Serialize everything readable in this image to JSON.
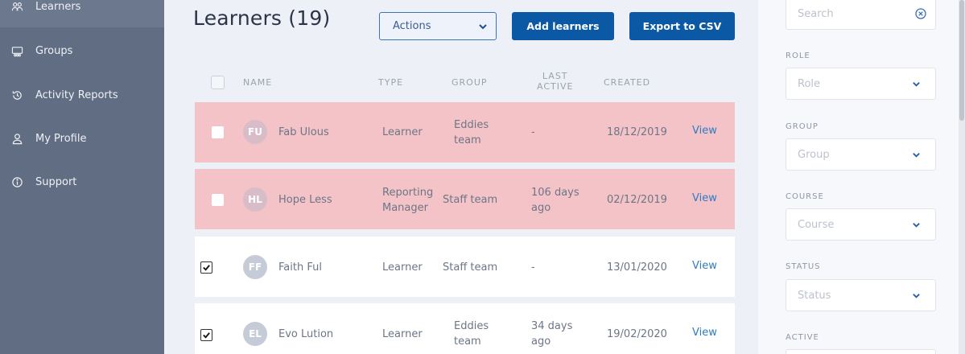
{
  "sidebar": {
    "items": [
      {
        "label": "Learners",
        "icon": "learners-icon"
      },
      {
        "label": "Groups",
        "icon": "groups-icon"
      },
      {
        "label": "Activity Reports",
        "icon": "history-icon"
      },
      {
        "label": "My Profile",
        "icon": "profile-icon"
      },
      {
        "label": "Support",
        "icon": "info-icon"
      }
    ]
  },
  "main": {
    "title": "Learners (19)",
    "actions_label": "Actions",
    "add_learners_label": "Add learners",
    "export_label": "Export to CSV",
    "columns": {
      "name": "NAME",
      "type": "TYPE",
      "group": "GROUP",
      "last_active_1": "LAST",
      "last_active_2": "ACTIVE",
      "created": "CREATED"
    },
    "rows": [
      {
        "initials": "FU",
        "name": "Fab Ulous",
        "type_1": "Learner",
        "type_2": "",
        "group_1": "Eddies",
        "group_2": "team",
        "last_1": "-",
        "last_2": "",
        "created": "18/12/2019",
        "view": "View",
        "checked": false
      },
      {
        "initials": "HL",
        "name": "Hope Less",
        "type_1": "Reporting",
        "type_2": "Manager",
        "group_1": "Staff team",
        "group_2": "",
        "last_1": "106 days",
        "last_2": "ago",
        "created": "02/12/2019",
        "view": "View",
        "checked": false
      },
      {
        "initials": "FF",
        "name": "Faith Ful",
        "type_1": "Learner",
        "type_2": "",
        "group_1": "Staff team",
        "group_2": "",
        "last_1": "-",
        "last_2": "",
        "created": "13/01/2020",
        "view": "View",
        "checked": true
      },
      {
        "initials": "EL",
        "name": "Evo Lution",
        "type_1": "Learner",
        "type_2": "",
        "group_1": "Eddies",
        "group_2": "team",
        "last_1": "34 days",
        "last_2": "ago",
        "created": "19/02/2020",
        "view": "View",
        "checked": true
      }
    ]
  },
  "filters": {
    "search_placeholder": "Search",
    "role_label": "ROLE",
    "role_placeholder": "Role",
    "group_label": "GROUP",
    "group_placeholder": "Group",
    "course_label": "COURSE",
    "course_placeholder": "Course",
    "status_label": "STATUS",
    "status_placeholder": "Status",
    "active_label": "ACTIVE"
  },
  "colors": {
    "sidebar": "#606d82",
    "primary_button": "#0b58a5",
    "highlight_row": "#f4c3c8",
    "link": "#2f7bc1"
  }
}
